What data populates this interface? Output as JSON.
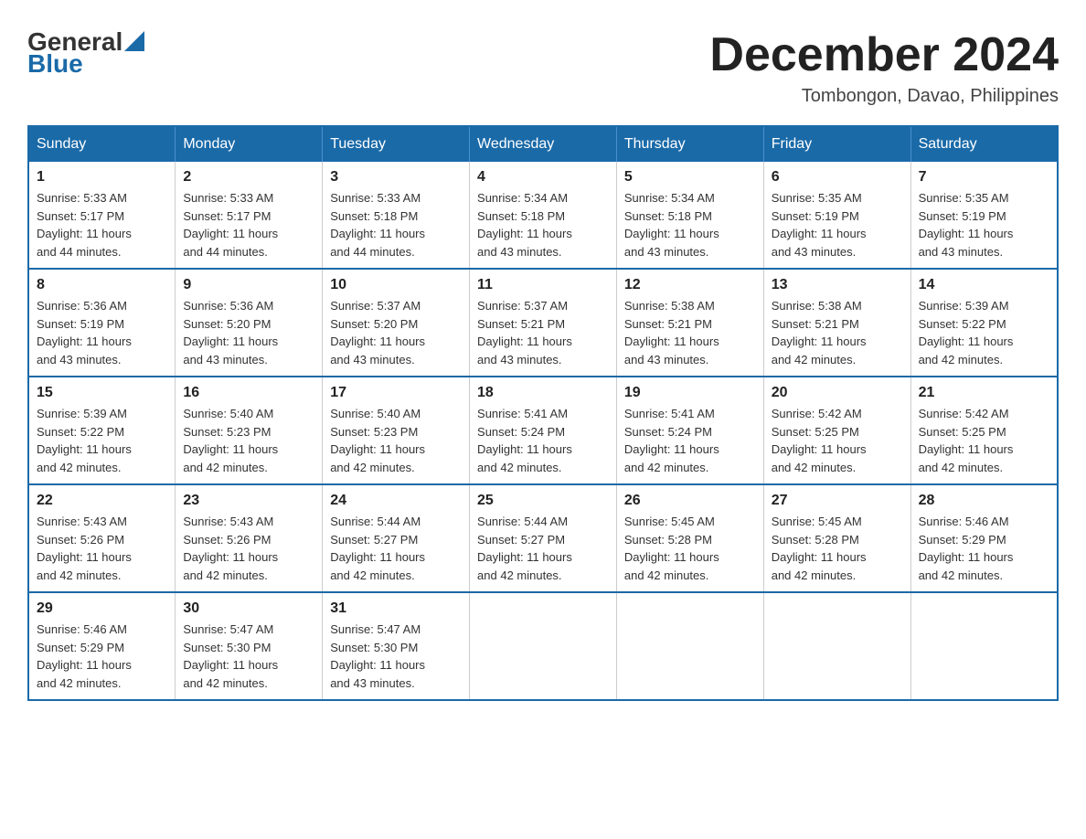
{
  "header": {
    "logo": {
      "general": "General",
      "blue": "Blue"
    },
    "title": "December 2024",
    "location": "Tombongon, Davao, Philippines"
  },
  "days_of_week": [
    "Sunday",
    "Monday",
    "Tuesday",
    "Wednesday",
    "Thursday",
    "Friday",
    "Saturday"
  ],
  "weeks": [
    [
      {
        "day": "1",
        "sunrise": "5:33 AM",
        "sunset": "5:17 PM",
        "daylight": "11 hours and 44 minutes."
      },
      {
        "day": "2",
        "sunrise": "5:33 AM",
        "sunset": "5:17 PM",
        "daylight": "11 hours and 44 minutes."
      },
      {
        "day": "3",
        "sunrise": "5:33 AM",
        "sunset": "5:18 PM",
        "daylight": "11 hours and 44 minutes."
      },
      {
        "day": "4",
        "sunrise": "5:34 AM",
        "sunset": "5:18 PM",
        "daylight": "11 hours and 43 minutes."
      },
      {
        "day": "5",
        "sunrise": "5:34 AM",
        "sunset": "5:18 PM",
        "daylight": "11 hours and 43 minutes."
      },
      {
        "day": "6",
        "sunrise": "5:35 AM",
        "sunset": "5:19 PM",
        "daylight": "11 hours and 43 minutes."
      },
      {
        "day": "7",
        "sunrise": "5:35 AM",
        "sunset": "5:19 PM",
        "daylight": "11 hours and 43 minutes."
      }
    ],
    [
      {
        "day": "8",
        "sunrise": "5:36 AM",
        "sunset": "5:19 PM",
        "daylight": "11 hours and 43 minutes."
      },
      {
        "day": "9",
        "sunrise": "5:36 AM",
        "sunset": "5:20 PM",
        "daylight": "11 hours and 43 minutes."
      },
      {
        "day": "10",
        "sunrise": "5:37 AM",
        "sunset": "5:20 PM",
        "daylight": "11 hours and 43 minutes."
      },
      {
        "day": "11",
        "sunrise": "5:37 AM",
        "sunset": "5:21 PM",
        "daylight": "11 hours and 43 minutes."
      },
      {
        "day": "12",
        "sunrise": "5:38 AM",
        "sunset": "5:21 PM",
        "daylight": "11 hours and 43 minutes."
      },
      {
        "day": "13",
        "sunrise": "5:38 AM",
        "sunset": "5:21 PM",
        "daylight": "11 hours and 42 minutes."
      },
      {
        "day": "14",
        "sunrise": "5:39 AM",
        "sunset": "5:22 PM",
        "daylight": "11 hours and 42 minutes."
      }
    ],
    [
      {
        "day": "15",
        "sunrise": "5:39 AM",
        "sunset": "5:22 PM",
        "daylight": "11 hours and 42 minutes."
      },
      {
        "day": "16",
        "sunrise": "5:40 AM",
        "sunset": "5:23 PM",
        "daylight": "11 hours and 42 minutes."
      },
      {
        "day": "17",
        "sunrise": "5:40 AM",
        "sunset": "5:23 PM",
        "daylight": "11 hours and 42 minutes."
      },
      {
        "day": "18",
        "sunrise": "5:41 AM",
        "sunset": "5:24 PM",
        "daylight": "11 hours and 42 minutes."
      },
      {
        "day": "19",
        "sunrise": "5:41 AM",
        "sunset": "5:24 PM",
        "daylight": "11 hours and 42 minutes."
      },
      {
        "day": "20",
        "sunrise": "5:42 AM",
        "sunset": "5:25 PM",
        "daylight": "11 hours and 42 minutes."
      },
      {
        "day": "21",
        "sunrise": "5:42 AM",
        "sunset": "5:25 PM",
        "daylight": "11 hours and 42 minutes."
      }
    ],
    [
      {
        "day": "22",
        "sunrise": "5:43 AM",
        "sunset": "5:26 PM",
        "daylight": "11 hours and 42 minutes."
      },
      {
        "day": "23",
        "sunrise": "5:43 AM",
        "sunset": "5:26 PM",
        "daylight": "11 hours and 42 minutes."
      },
      {
        "day": "24",
        "sunrise": "5:44 AM",
        "sunset": "5:27 PM",
        "daylight": "11 hours and 42 minutes."
      },
      {
        "day": "25",
        "sunrise": "5:44 AM",
        "sunset": "5:27 PM",
        "daylight": "11 hours and 42 minutes."
      },
      {
        "day": "26",
        "sunrise": "5:45 AM",
        "sunset": "5:28 PM",
        "daylight": "11 hours and 42 minutes."
      },
      {
        "day": "27",
        "sunrise": "5:45 AM",
        "sunset": "5:28 PM",
        "daylight": "11 hours and 42 minutes."
      },
      {
        "day": "28",
        "sunrise": "5:46 AM",
        "sunset": "5:29 PM",
        "daylight": "11 hours and 42 minutes."
      }
    ],
    [
      {
        "day": "29",
        "sunrise": "5:46 AM",
        "sunset": "5:29 PM",
        "daylight": "11 hours and 42 minutes."
      },
      {
        "day": "30",
        "sunrise": "5:47 AM",
        "sunset": "5:30 PM",
        "daylight": "11 hours and 42 minutes."
      },
      {
        "day": "31",
        "sunrise": "5:47 AM",
        "sunset": "5:30 PM",
        "daylight": "11 hours and 43 minutes."
      },
      null,
      null,
      null,
      null
    ]
  ],
  "labels": {
    "sunrise": "Sunrise:",
    "sunset": "Sunset:",
    "daylight": "Daylight:"
  }
}
